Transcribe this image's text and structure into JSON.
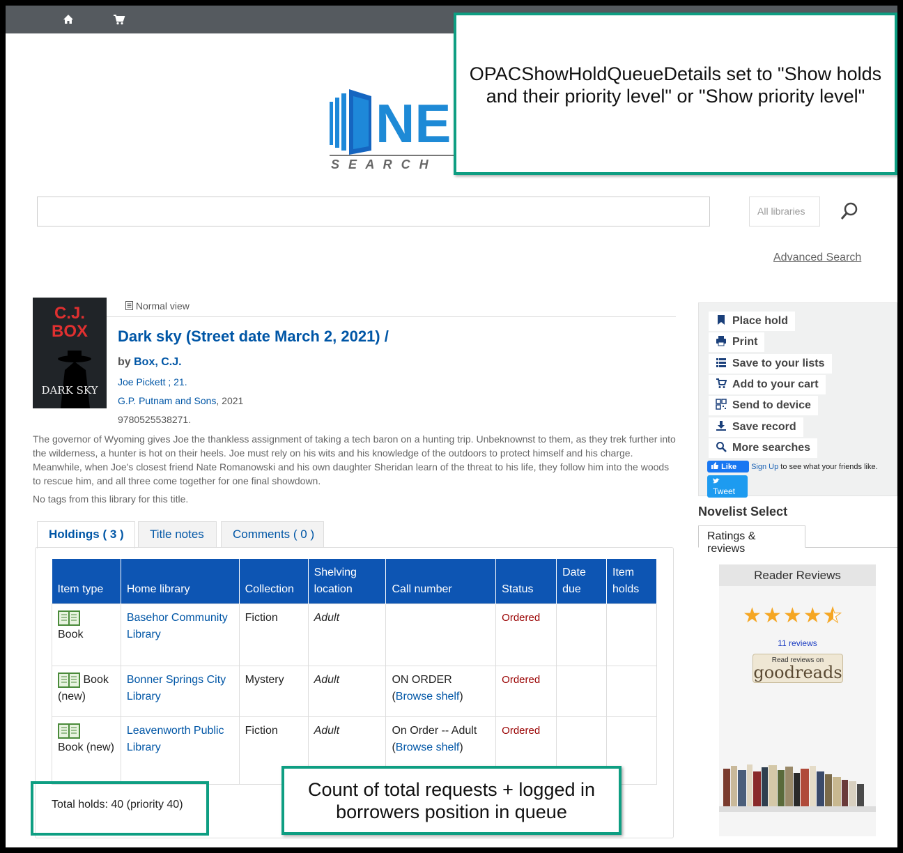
{
  "topbar": {
    "home_icon": "home-icon",
    "cart_icon": "cart-icon"
  },
  "logo": {
    "mark": "NE",
    "subtitle": "S E A R C H"
  },
  "search": {
    "library_select": "All libraries",
    "advanced_link": "Advanced Search"
  },
  "record": {
    "normal_view": "Normal view",
    "title": "Dark sky (Street date March 2, 2021) /",
    "by_label": "by",
    "author": "Box, C.J.",
    "series": "Joe Pickett ; 21.",
    "publisher": "G.P. Putnam and Sons",
    "pub_year": ", 2021",
    "isbn": "9780525538271.",
    "summary": "The governor of Wyoming gives Joe the thankless assignment of taking a tech baron on a hunting trip. Unbeknownst to them, as they trek further into the wilderness, a hunter is hot on their heels. Joe must rely on his wits and his knowledge of the outdoors to protect himself and his charge. Meanwhile, when Joe's closest friend Nate Romanowski and his own daughter Sheridan learn of the threat to his life, they follow him into the woods to rescue him, and all three come together for one final showdown.",
    "tags": "No tags from this library for this title.",
    "cover": {
      "author_text": "C.J. BOX",
      "title_text": "DARK SKY"
    }
  },
  "tabs": {
    "holdings": "Holdings ( 3 )",
    "title_notes": "Title notes",
    "comments": "Comments ( 0 )"
  },
  "holdings": {
    "headers": [
      "Item type",
      "Home library",
      "Collection",
      "Shelving location",
      "Call number",
      "Status",
      "Date due",
      "Item holds"
    ],
    "rows": [
      {
        "item_type": "Book",
        "library": "Basehor Community Library",
        "collection": "Fiction",
        "location": "Adult",
        "call_number": "",
        "status": "Ordered"
      },
      {
        "item_type": "Book (new)",
        "library": "Bonner Springs City Library",
        "collection": "Mystery",
        "location": "Adult",
        "call_number": "ON ORDER",
        "status": "Ordered"
      },
      {
        "item_type": "Book (new)",
        "library": "Leavenworth Public Library",
        "collection": "Fiction",
        "location": "Adult",
        "call_number": "On Order -- Adult",
        "status": "Ordered"
      }
    ],
    "browse_shelf": "Browse shelf",
    "total_holds": "Total holds: 40 (priority 40)"
  },
  "actions": {
    "place_hold": "Place hold",
    "print": "Print",
    "save_lists": "Save to your lists",
    "add_cart": "Add to your cart",
    "send_device": "Send to device",
    "save_record": "Save record",
    "more_searches": "More searches"
  },
  "social": {
    "like": "Like",
    "signup": "Sign Up",
    "friends_text": " to see what your friends like.",
    "tweet": "Tweet"
  },
  "novelist": {
    "title": "Novelist Select",
    "tab": "Ratings & reviews",
    "reader_reviews": "Reader Reviews",
    "rating": 4.5,
    "reviews_count": "11 reviews",
    "goodreads_small": "Read reviews on",
    "goodreads_brand": "goodreads"
  },
  "callouts": {
    "top": "OPACShowHoldQueueDetails set to \"Show holds and their priority level\" or \"Show priority level\"",
    "bottom": "Count of total requests + logged in borrowers position in queue"
  },
  "colors": {
    "accent": "#0056a6",
    "table_header": "#0d55b3",
    "callout_border": "#0e9e82",
    "status": "#990000"
  }
}
